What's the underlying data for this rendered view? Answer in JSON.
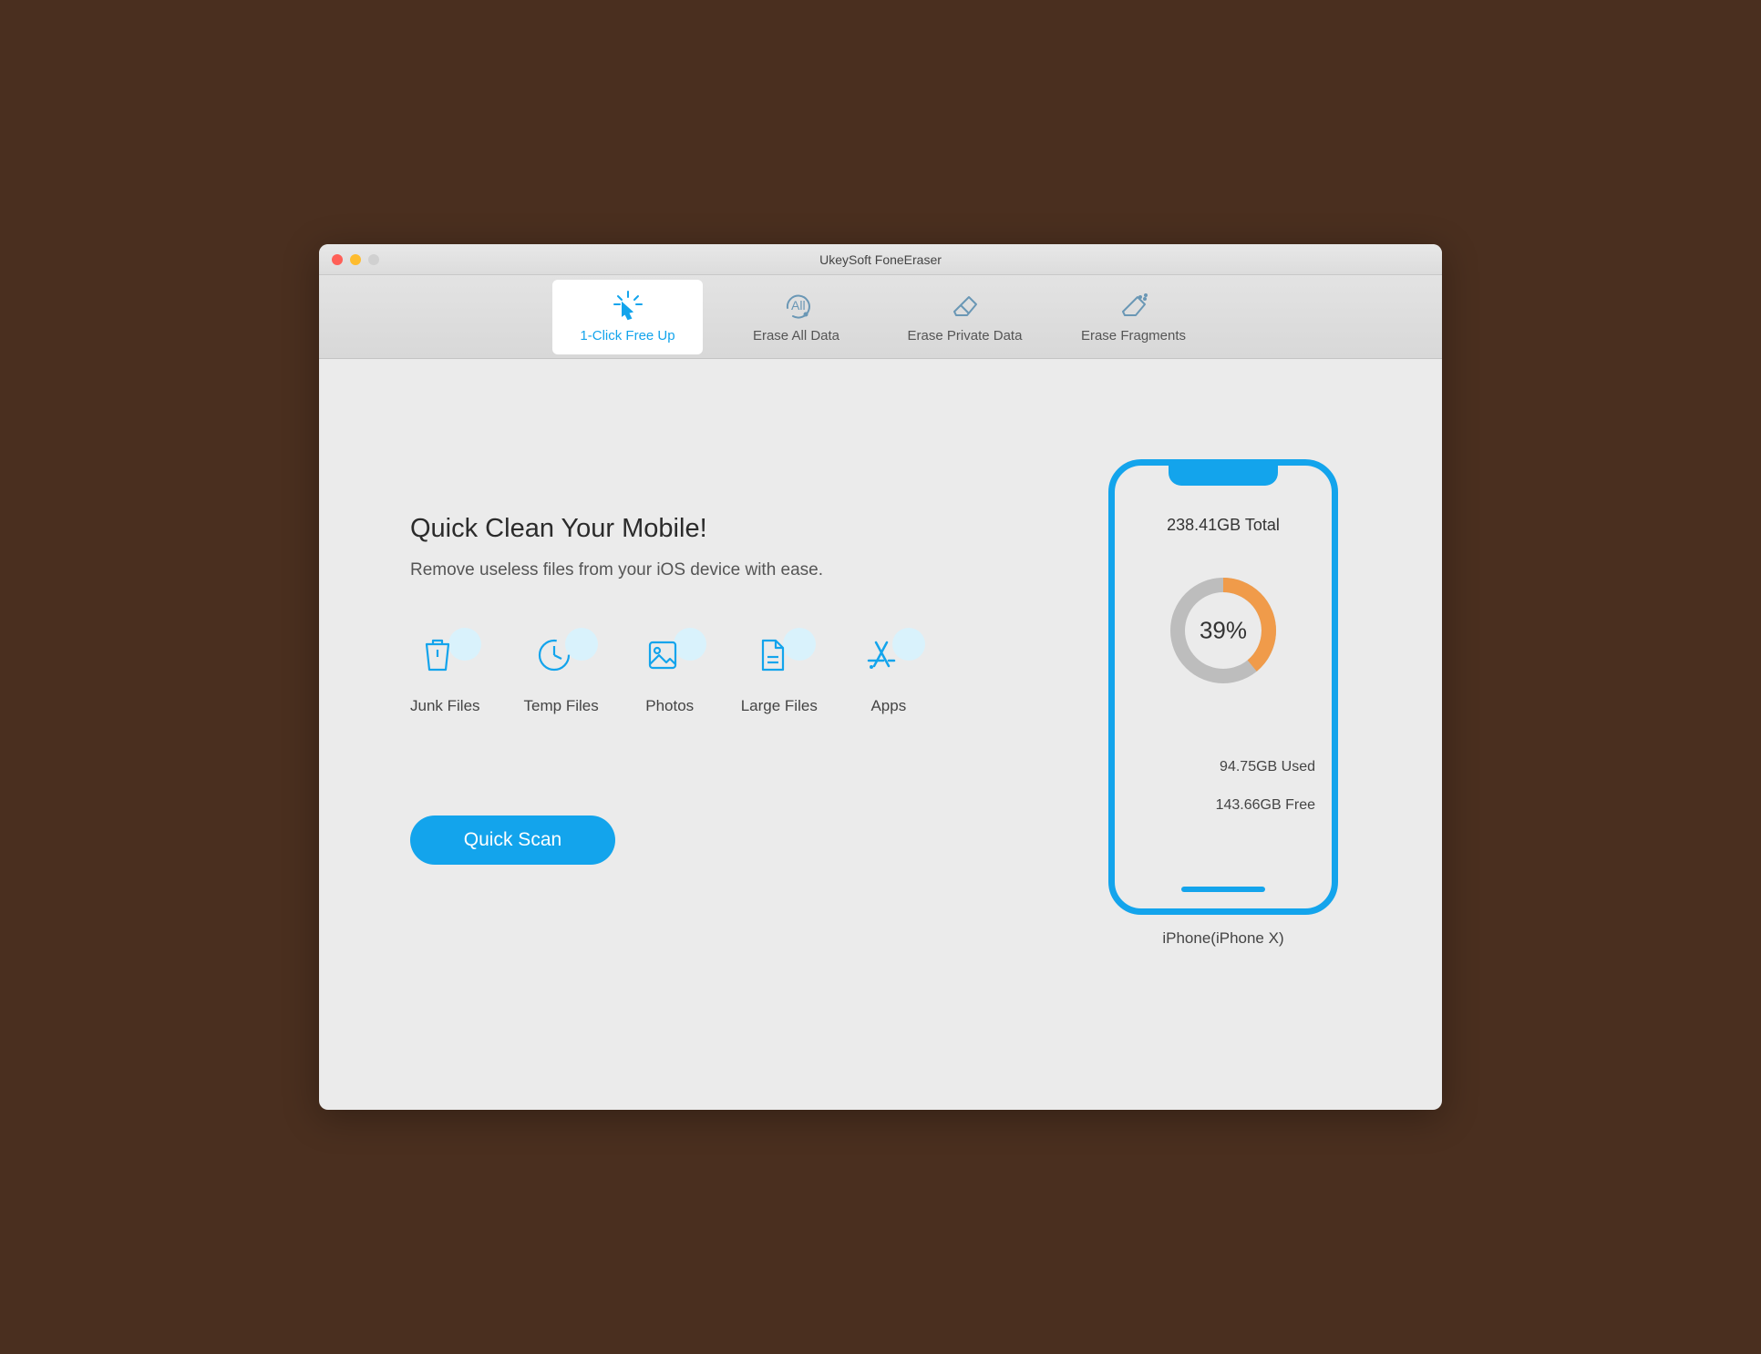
{
  "window": {
    "title": "UkeySoft FoneEraser"
  },
  "tabs": [
    {
      "label": "1-Click Free Up"
    },
    {
      "label": "Erase All Data"
    },
    {
      "label": "Erase Private Data"
    },
    {
      "label": "Erase Fragments"
    }
  ],
  "main": {
    "heading": "Quick Clean Your Mobile!",
    "subheading": "Remove useless files from your iOS device with ease.",
    "categories": [
      {
        "label": "Junk Files"
      },
      {
        "label": "Temp Files"
      },
      {
        "label": "Photos"
      },
      {
        "label": "Large Files"
      },
      {
        "label": "Apps"
      }
    ],
    "scan_button": "Quick Scan"
  },
  "device": {
    "total": "238.41GB Total",
    "percent": "39%",
    "percent_num": 39,
    "used": "94.75GB Used",
    "free": "143.66GB Free",
    "name": "iPhone(iPhone X)"
  },
  "chart_data": {
    "type": "pie",
    "title": "Storage Usage",
    "series": [
      {
        "name": "Used",
        "value": 94.75,
        "unit": "GB",
        "percent": 39
      },
      {
        "name": "Free",
        "value": 143.66,
        "unit": "GB",
        "percent": 61
      }
    ],
    "total": 238.41,
    "total_unit": "GB"
  }
}
